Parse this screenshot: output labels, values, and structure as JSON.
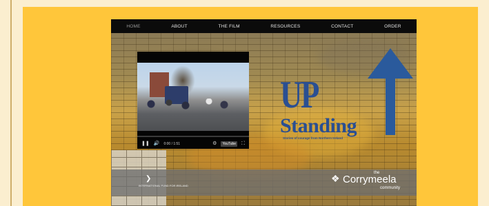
{
  "nav": {
    "items": [
      {
        "label": "HOME",
        "active": true
      },
      {
        "label": "ABOUT",
        "active": false
      },
      {
        "label": "THE FILM",
        "active": false
      },
      {
        "label": "RESOURCES",
        "active": false
      },
      {
        "label": "CONTACT",
        "active": false
      },
      {
        "label": "ORDER",
        "active": false
      }
    ]
  },
  "video": {
    "time": "0:00 / 1:51",
    "progress": 0.0,
    "icons": [
      "pause-icon",
      "volume-icon",
      "settings-icon",
      "youtube-icon",
      "fullscreen-icon"
    ],
    "yt_label": "YouTube"
  },
  "branding": {
    "title_line1": "UP",
    "title_line2": "Standing",
    "tagline": "Stories of courage from Northern Ireland",
    "accent_color": "#2a5a9c"
  },
  "footer": {
    "left_logo_text": "INTERNATIONAL FUND FOR IRELAND",
    "right_logo_the": "the",
    "right_logo_name": "Corrymeela",
    "right_logo_community": "community"
  }
}
